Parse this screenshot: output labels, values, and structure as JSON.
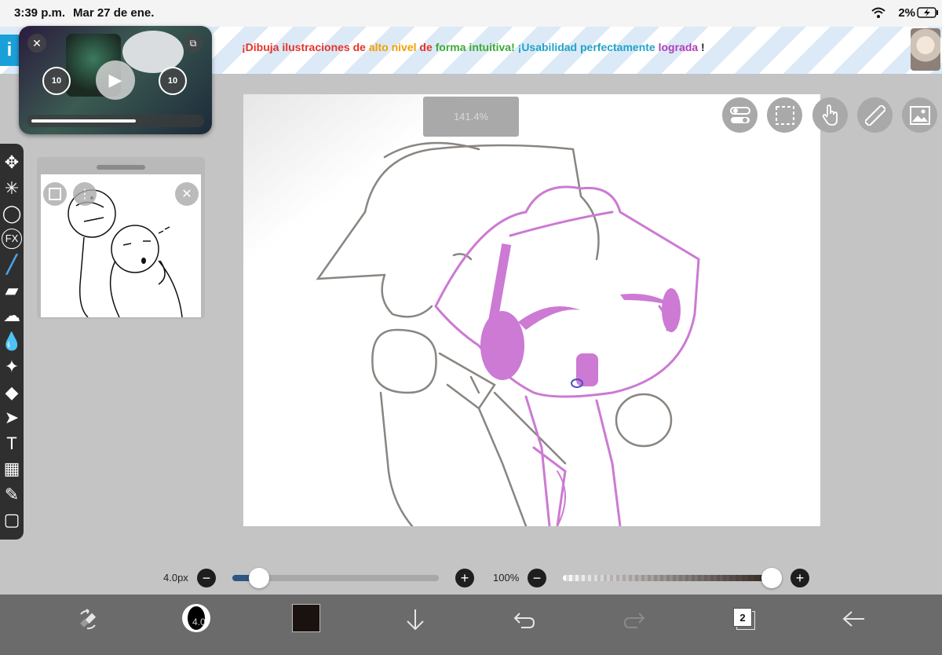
{
  "status_bar": {
    "time": "3:39 p.m.",
    "date": "Mar 27 de ene.",
    "battery": "2%"
  },
  "ad_banner": {
    "segments": [
      {
        "text": "¡Dibuja ilustraciones de ",
        "color": "#e5332a"
      },
      {
        "text": "alto nivel ",
        "color": "#f2a000"
      },
      {
        "text": "de ",
        "color": "#e5332a"
      },
      {
        "text": "forma intuitiva! ",
        "color": "#3aa935"
      },
      {
        "text": "¡Usabilidad perfectamente ",
        "color": "#1fa3c8"
      },
      {
        "text": "lograda",
        "color": "#b03fb8"
      },
      {
        "text": " !",
        "color": "#222222"
      }
    ]
  },
  "video_pip": {
    "skip_back_label": "10",
    "skip_forward_label": "10",
    "progress": 0.62
  },
  "canvas": {
    "zoom_label": "141.4%"
  },
  "top_icons": [
    "toggle-icon",
    "selection-icon",
    "touch-gesture-icon",
    "ruler-icon",
    "image-icon"
  ],
  "tools": [
    {
      "name": "move-tool",
      "glyph": "✥"
    },
    {
      "name": "magic-wand-tool",
      "glyph": "✳"
    },
    {
      "name": "lasso-tool",
      "glyph": "◯"
    },
    {
      "name": "fx-tool",
      "glyph": "FX"
    },
    {
      "name": "brush-tool",
      "glyph": "╱"
    },
    {
      "name": "eraser-tool",
      "glyph": "▰"
    },
    {
      "name": "smudge-tool",
      "glyph": "☁"
    },
    {
      "name": "blur-tool",
      "glyph": "💧"
    },
    {
      "name": "magic-brush-tool",
      "glyph": "✦"
    },
    {
      "name": "fill-tool",
      "glyph": "◆"
    },
    {
      "name": "select-tool",
      "glyph": "➤"
    },
    {
      "name": "text-tool",
      "glyph": "T"
    },
    {
      "name": "frame-divider-tool",
      "glyph": "▦"
    },
    {
      "name": "eyedropper-tool",
      "glyph": "✎"
    },
    {
      "name": "canvas-tool",
      "glyph": "▢"
    }
  ],
  "sliders": {
    "brush_size_label": "4.0px",
    "brush_size_fraction": 0.13,
    "opacity_label": "100%",
    "opacity_fraction": 1.0
  },
  "bottom_bar": {
    "brush_size_value": "4.0",
    "color_hex": "#1a120e",
    "layer_count": "2"
  }
}
